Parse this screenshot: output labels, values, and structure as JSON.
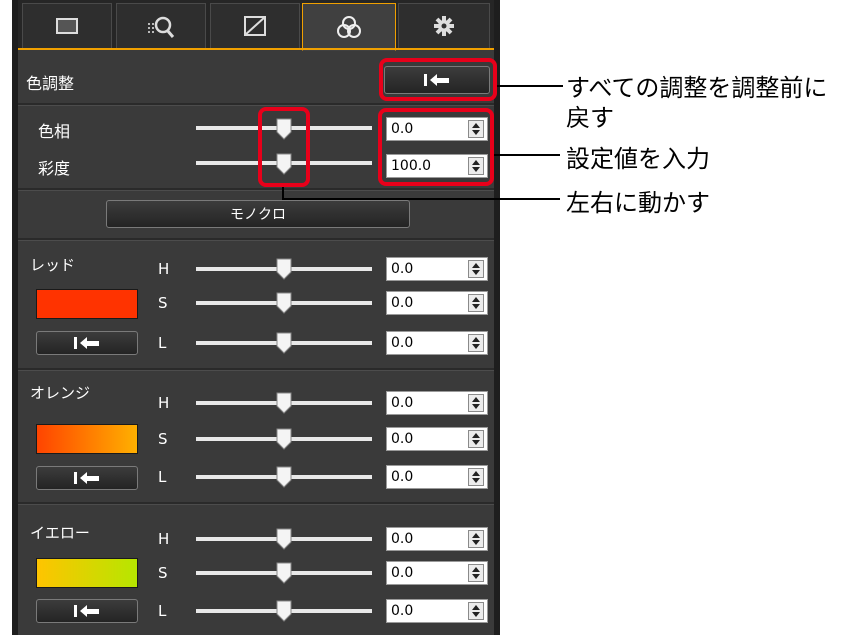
{
  "tabs": [
    {
      "icon": "basic-adjust-icon"
    },
    {
      "icon": "tone-curve-grid-icon"
    },
    {
      "icon": "tone-curve-icon"
    },
    {
      "icon": "color-adjust-icon",
      "active": true
    },
    {
      "icon": "settings-gear-icon"
    }
  ],
  "header": {
    "title": "色調整"
  },
  "master": {
    "hue_label": "色相",
    "saturation_label": "彩度",
    "hue_value": "0.0",
    "saturation_value": "100.0",
    "hue_slider_level": 0.5,
    "saturation_slider_level": 0.5
  },
  "mono_button": {
    "label": "モノクロ"
  },
  "channel_labels": {
    "h": "H",
    "s": "S",
    "l": "L"
  },
  "groups": [
    {
      "name": "レッド",
      "swatch": [
        "#ff3300",
        "#ff3300"
      ],
      "h": "0.0",
      "s": "0.0",
      "l": "0.0"
    },
    {
      "name": "オレンジ",
      "swatch": [
        "#ff4400",
        "#ffb000"
      ],
      "h": "0.0",
      "s": "0.0",
      "l": "0.0"
    },
    {
      "name": "イエロー",
      "swatch": [
        "#ffc400",
        "#b6e600"
      ],
      "h": "0.0",
      "s": "0.0",
      "l": "0.0"
    }
  ],
  "callouts": {
    "reset_all_line1": "すべての調整を調整前に",
    "reset_all_line2": "戻す",
    "enter_value": "設定値を入力",
    "move_left_right": "左右に動かす"
  },
  "colors": {
    "highlight": "#e8001a",
    "active_tab": "#f0a000",
    "panel": "#3a3a3a"
  }
}
